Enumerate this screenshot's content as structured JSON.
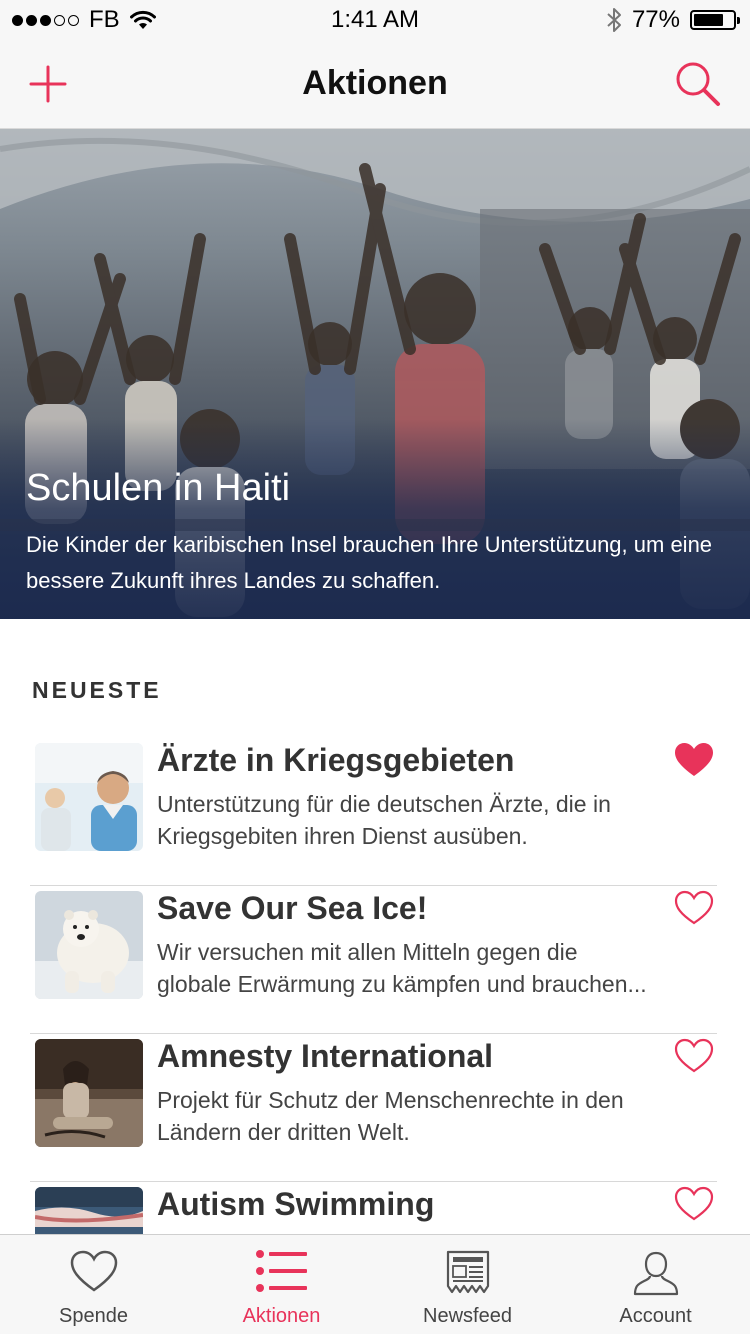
{
  "status_bar": {
    "carrier": "FB",
    "time": "1:41 AM",
    "battery_percent": "77%",
    "battery_level": 0.77,
    "signal_bars_filled": 3,
    "signal_bars_total": 5
  },
  "nav": {
    "title": "Aktionen",
    "left_icon": "plus-icon",
    "right_icon": "search-icon"
  },
  "hero": {
    "title": "Schulen in Haiti",
    "description": "Die Kinder der karibischen Insel brauchen Ihre Unterstützung, um eine bessere Zukunft ihres Landes zu schaffen."
  },
  "section": {
    "heading": "NEUESTE"
  },
  "items": [
    {
      "title": "Ärzte in Kriegsgebieten",
      "description": "Unterstützung für die deutschen Ärzte, die in Kriegsgebiten ihren Dienst ausüben.",
      "favorited": true
    },
    {
      "title": "Save Our Sea Ice!",
      "description": "Wir versuchen mit allen Mitteln gegen die globale Erwärmung zu kämpfen und brauchen...",
      "favorited": false
    },
    {
      "title": "Amnesty International",
      "description": "Projekt für Schutz der Menschenrechte in den Ländern der dritten Welt.",
      "favorited": false
    },
    {
      "title": "Autism Swimming",
      "description": "",
      "favorited": false
    }
  ],
  "tabs": [
    {
      "label": "Spende",
      "icon": "heart-outline-icon",
      "active": false
    },
    {
      "label": "Aktionen",
      "icon": "list-icon",
      "active": true
    },
    {
      "label": "Newsfeed",
      "icon": "newspaper-icon",
      "active": false
    },
    {
      "label": "Account",
      "icon": "user-icon",
      "active": false
    }
  ],
  "colors": {
    "accent": "#e8335a",
    "hero_overlay": "#1e2d50",
    "background": "#ffffff",
    "bar_background": "#f7f7f7"
  }
}
